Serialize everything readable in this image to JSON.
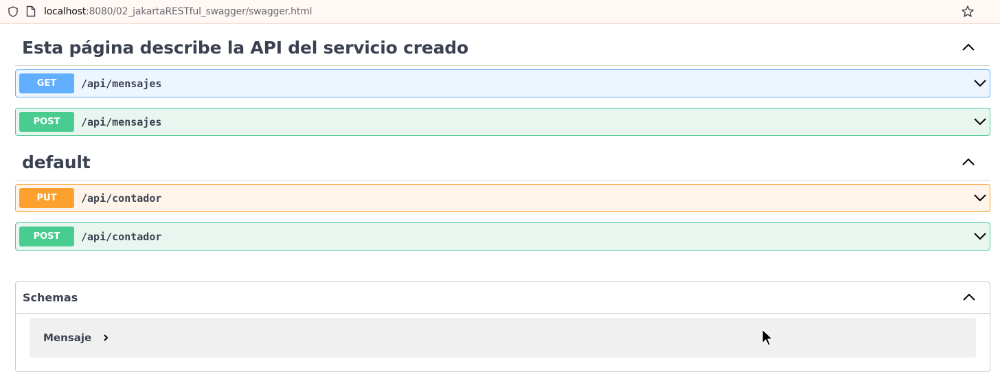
{
  "browser": {
    "url_host": "localhost",
    "url_path": ":8080/02_jakartaRESTful_swagger/swagger.html"
  },
  "sections": [
    {
      "title": "Esta página describe la API del servicio creado",
      "operations": [
        {
          "method": "GET",
          "path": "/api/mensajes",
          "color": "#61affe"
        },
        {
          "method": "POST",
          "path": "/api/mensajes",
          "color": "#49cc90"
        }
      ]
    },
    {
      "title": "default",
      "operations": [
        {
          "method": "PUT",
          "path": "/api/contador",
          "color": "#fca130"
        },
        {
          "method": "POST",
          "path": "/api/contador",
          "color": "#49cc90"
        }
      ]
    }
  ],
  "schemas": {
    "title": "Schemas",
    "models": [
      {
        "name": "Mensaje"
      }
    ]
  },
  "icons": {
    "security": "shield-icon",
    "page": "page-icon",
    "bookmark": "star-icon",
    "expand": "chevron-down-icon",
    "collapse": "chevron-up-icon",
    "model_expand": "chevron-right-icon",
    "cursor": "mouse-pointer-icon"
  }
}
